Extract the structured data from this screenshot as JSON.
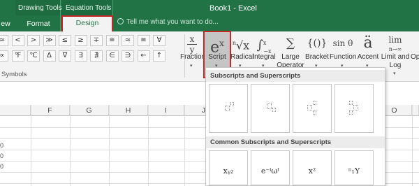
{
  "titlebar": {
    "drawing_tools": "Drawing Tools",
    "equation_tools": "Equation Tools",
    "document_title": "Book1 - Excel",
    "tabs": {
      "view_partial": "ew",
      "format": "Format",
      "design": "Design"
    },
    "tell_me_placeholder": "Tell me what you want to do..."
  },
  "symbols_group": {
    "label": "Symbols",
    "row1": [
      "±",
      "∞",
      "=",
      "≠",
      "~",
      "×",
      "÷",
      "!",
      "∝",
      "<",
      "≪",
      ">",
      "≫",
      "≤",
      "≥",
      "∓",
      "≅",
      "≈",
      "≡",
      "∀"
    ],
    "row2": [
      "∁",
      "∂",
      "√",
      "∛",
      "∜",
      "∪",
      "∩",
      "∅",
      "%",
      "°",
      "℉",
      "℃",
      "∆",
      "∇",
      "∃",
      "∄",
      "∈",
      "∋",
      "←",
      "↑"
    ],
    "row1_visible": [
      "≈",
      "<",
      ">",
      "≫",
      "≤",
      "≥",
      "∓",
      "≅",
      "≈",
      "≡",
      "∀"
    ],
    "row2_visible": [
      "∝",
      "℉",
      "℃",
      "∆",
      "∇",
      "∃",
      "∄",
      "∈",
      "∋",
      "←",
      "↑"
    ]
  },
  "structures": {
    "fraction": {
      "label": "Fraction",
      "glyph": "x⁄y"
    },
    "script": {
      "label": "Script",
      "glyph": "eˣ"
    },
    "radical": {
      "label": "Radical",
      "glyph": "ⁿ√x"
    },
    "integral": {
      "label": "Integral",
      "glyph": "∫ˣ₋ˣ"
    },
    "large_operator": {
      "label_line1": "Large",
      "label_line2": "Operator",
      "glyph": "∑"
    },
    "bracket": {
      "label": "Bracket",
      "glyph": "{()}"
    },
    "function": {
      "label": "Function",
      "glyph": "sin θ"
    },
    "accent": {
      "label": "Accent",
      "glyph": "ä"
    },
    "limit_and_log": {
      "label_line1": "Limit and",
      "label_line2": "Log",
      "glyph": "lim"
    },
    "operator_partial": {
      "label": "Ope",
      "glyph": ""
    }
  },
  "columns": [
    "F",
    "G",
    "H",
    "I",
    "J",
    "O"
  ],
  "row_edge_digits": [
    "0",
    "0",
    "0"
  ],
  "gallery": {
    "section1": "Subscripts and Superscripts",
    "section2": "Common Subscripts and Superscripts",
    "common": [
      "xᵧ₂",
      "e⁻ⁱωᵗ",
      "x²",
      "ⁿ₁Y"
    ]
  }
}
